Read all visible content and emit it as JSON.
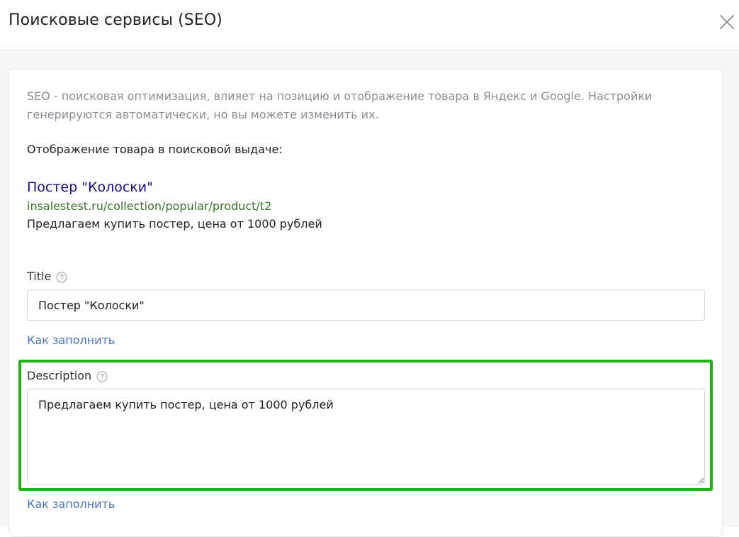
{
  "header": {
    "title": "Поисковые сервисы (SEO)",
    "close_icon": "close-icon"
  },
  "intro": {
    "text": "SEO - поисковая оптимизация, влияет на позицию и отображение товара в Яндекс и Google. Настройки генерируются автоматически, но вы можете изменить их."
  },
  "preview": {
    "label": "Отображение товара в поисковой выдаче:",
    "title": "Постер \"Колоски\"",
    "url": "insalestest.ru/collection/popular/product/t2",
    "description": "Предлагаем купить постер, цена от 1000 рублей"
  },
  "title_field": {
    "label": "Title",
    "value": "Постер \"Колоски\"",
    "help_link": "Как заполнить",
    "help_icon": "help-circle-icon"
  },
  "description_field": {
    "label": "Description",
    "value": "Предлагаем купить постер, цена от 1000 рублей",
    "help_link": "Как заполнить",
    "help_icon": "help-circle-icon"
  },
  "colors": {
    "highlight": "#1fb40f",
    "preview_title": "#1a0a8c",
    "preview_url": "#3c6e2e",
    "link": "#4a72c4",
    "muted_text": "#8a8d93"
  }
}
